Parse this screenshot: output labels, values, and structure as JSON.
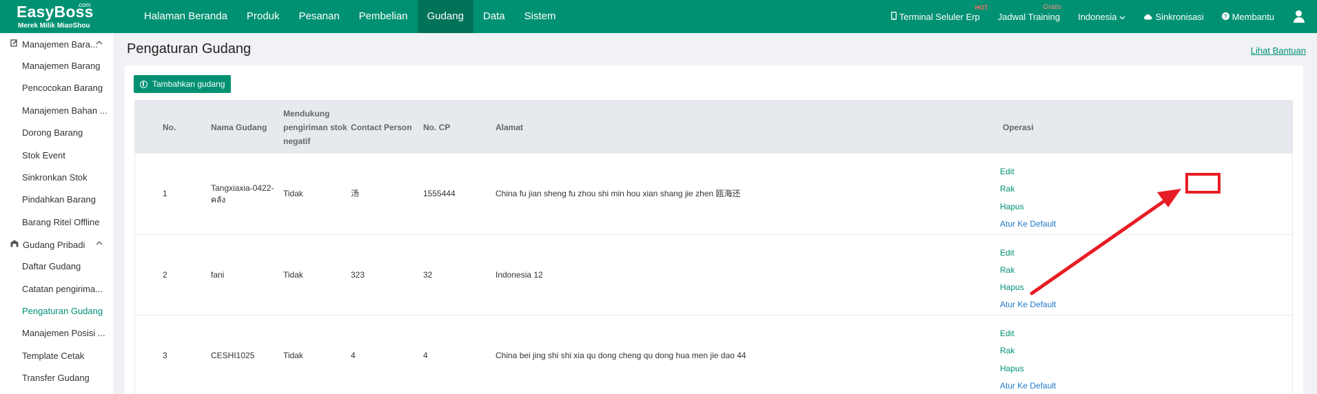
{
  "brand": {
    "name": "EasyBoss",
    "com": ".com",
    "tagline": "Merek Milik MiaoShou"
  },
  "nav": [
    {
      "label": "Halaman Beranda",
      "active": false
    },
    {
      "label": "Produk",
      "active": false
    },
    {
      "label": "Pesanan",
      "active": false
    },
    {
      "label": "Pembelian",
      "active": false
    },
    {
      "label": "Gudang",
      "active": true
    },
    {
      "label": "Data",
      "active": false
    },
    {
      "label": "Sistem",
      "active": false
    }
  ],
  "topRight": {
    "terminal": "Terminal Seluler Erp",
    "terminal_badge": "HOT",
    "training": "Jadwal Training",
    "training_badge": "Gratis",
    "language": "Indonesia",
    "sync": "Sinkronisasi",
    "help": "Membantu"
  },
  "sidebar": {
    "group1": "Manajemen Bara...",
    "group1_items": [
      "Manajemen Barang",
      "Pencocokan Barang",
      "Manajemen Bahan ...",
      "Dorong Barang",
      "Stok Event",
      "Sinkronkan Stok",
      "Pindahkan Barang",
      "Barang Ritel Offline"
    ],
    "group2": "Gudang Pribadi",
    "group2_items": [
      "Daftar Gudang",
      "Catatan pengirima...",
      "Pengaturan Gudang",
      "Manajemen Posisi ...",
      "Template Cetak",
      "Transfer Gudang"
    ],
    "active_item": "Pengaturan Gudang"
  },
  "page": {
    "title": "Pengaturan Gudang",
    "help_link": "Lihat Bantuan",
    "add_button": "Tambahkan gudang"
  },
  "table": {
    "headers": {
      "no": "No.",
      "name": "Nama Gudang",
      "negative": "Mendukung pengiriman stok negatif",
      "contact": "Contact Person",
      "phone": "No. CP",
      "address": "Alamat",
      "operation": "Operasi"
    },
    "rows": [
      {
        "no": "1",
        "name": "Tangxiaxia-0422-คลัง",
        "negative": "Tidak",
        "contact": "汤",
        "phone": "1555444",
        "address": "China fu jian sheng fu zhou shi min hou xian shang jie zhen 瓯海还"
      },
      {
        "no": "2",
        "name": "fani",
        "negative": "Tidak",
        "contact": "323",
        "phone": "32",
        "address": "Indonesia 12"
      },
      {
        "no": "3",
        "name": "CESHI1025",
        "negative": "Tidak",
        "contact": "4",
        "phone": "4",
        "address": "China bei jing shi shi xia qu dong cheng qu dong hua men jie dao 44"
      }
    ],
    "ops": {
      "edit": "Edit",
      "rack": "Rak",
      "delete": "Hapus",
      "default": "Atur Ke Default"
    }
  },
  "colors": {
    "primary": "#009173",
    "nav_active": "#007358",
    "link_blue": "#1f78c8",
    "annotation": "#e81c24"
  }
}
